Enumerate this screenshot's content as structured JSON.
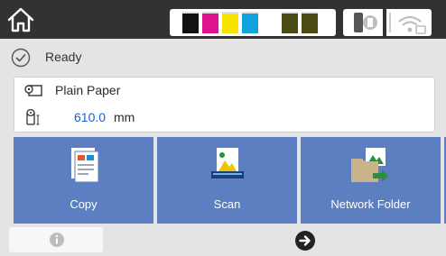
{
  "top_bar": {
    "home_icon": "home-icon",
    "ink_levels": {
      "black": 0.9,
      "magenta": 0.9,
      "yellow": 0.9,
      "cyan": 0.9,
      "matte_black_1": 0.9,
      "matte_black_2": 0.9
    },
    "ink_colors": {
      "black": "#111111",
      "magenta": "#e0118c",
      "yellow": "#f7e200",
      "cyan": "#12a3de",
      "matte_black_1": "#4a4a14",
      "matte_black_2": "#4a4a14"
    },
    "maintenance_icon": "maintenance-box-icon",
    "network_icon": "wifi-disabled-icon"
  },
  "status": {
    "icon": "check-circle-icon",
    "label": "Ready"
  },
  "paper": {
    "type_icon": "paper-roll-icon",
    "type": "Plain Paper",
    "length_icon": "roll-length-icon",
    "length_value": "610.0",
    "length_unit": "mm"
  },
  "functions": [
    {
      "label": "Copy",
      "icon": "copy-icon"
    },
    {
      "label": "Scan",
      "icon": "scan-icon"
    },
    {
      "label": "Network Folder",
      "icon": "network-folder-icon"
    }
  ],
  "bottom_bar": {
    "info_icon": "info-icon",
    "next_icon": "next-arrow-icon"
  },
  "colors": {
    "tile_bg": "#5b7fc0",
    "top_bar_bg": "#323232",
    "screen_bg": "#e4e4e4",
    "accent_blue": "#1a5fd0"
  }
}
